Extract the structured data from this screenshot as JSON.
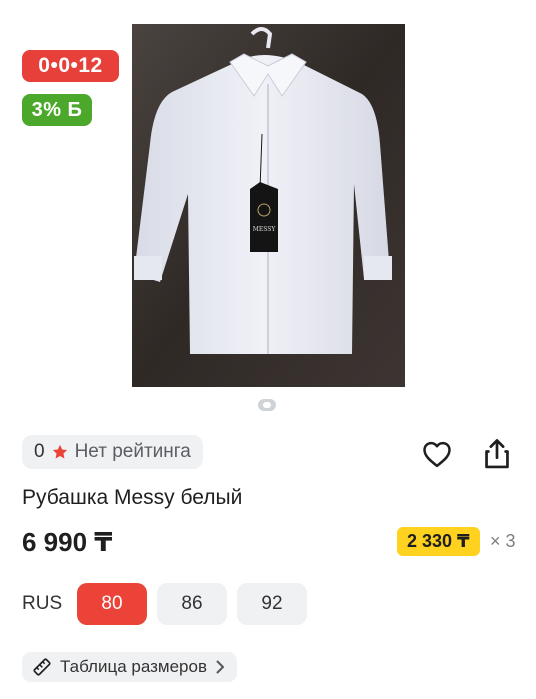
{
  "product": {
    "image_alt": "white shirt on hanger with MESSY tag",
    "tag_brand": "MESSY",
    "title": "Рубашка Messy белый",
    "price": "6 990 ₸",
    "installment": {
      "amount": "2 330 ₸",
      "multiplier": "× 3"
    }
  },
  "badges": {
    "timer": "0•0•12",
    "bonus": "3% Б"
  },
  "rating": {
    "value": "0",
    "text": "Нет рейтинга"
  },
  "pager": {
    "current": 1,
    "total": 1
  },
  "sizes": {
    "label": "RUS",
    "options": [
      "80",
      "86",
      "92"
    ],
    "selected": "80"
  },
  "size_chart": {
    "label": "Таблица размеров"
  },
  "colors": {
    "accent_red": "#ec4338",
    "bonus_green": "#4ca82b",
    "installment_yellow": "#ffd21f"
  },
  "icons": [
    "heart-icon",
    "share-icon",
    "star-icon",
    "ruler-icon",
    "chevron-right-icon"
  ]
}
